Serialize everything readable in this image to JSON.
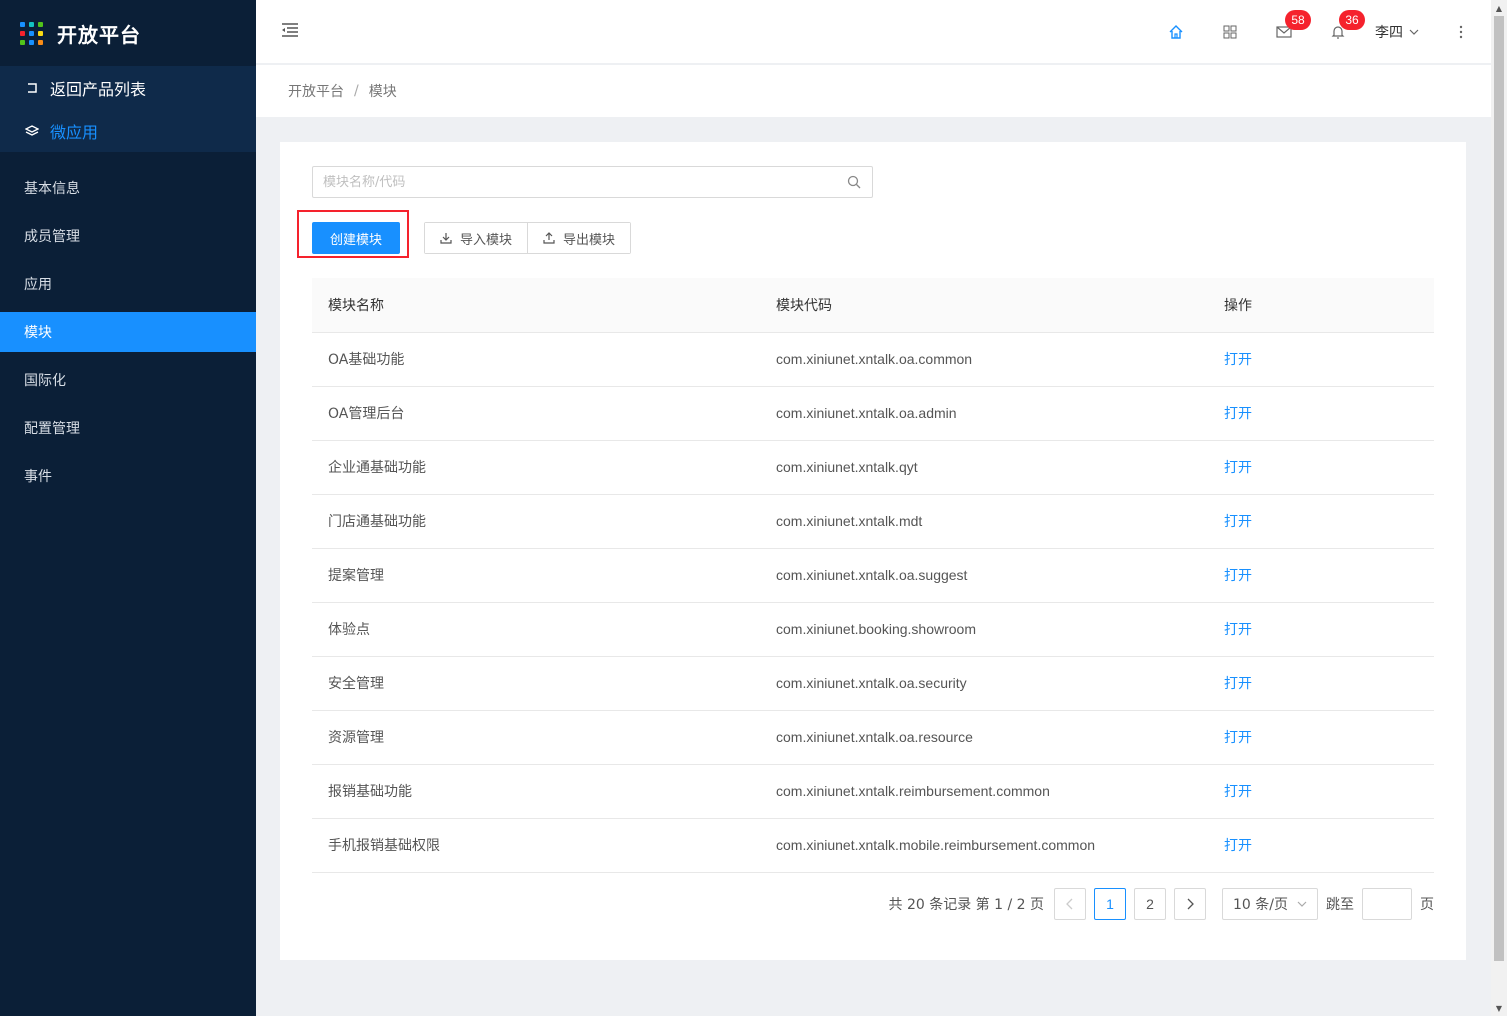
{
  "brand": {
    "title": "开放平台"
  },
  "sub_nav": {
    "back_label": "返回产品列表",
    "app_label": "微应用"
  },
  "menu": [
    {
      "label": "基本信息"
    },
    {
      "label": "成员管理"
    },
    {
      "label": "应用"
    },
    {
      "label": "模块"
    },
    {
      "label": "国际化"
    },
    {
      "label": "配置管理"
    },
    {
      "label": "事件"
    }
  ],
  "header": {
    "mail_badge": "58",
    "bell_badge": "36",
    "user_name": "李四"
  },
  "breadcrumb": {
    "root": "开放平台",
    "sep": "/",
    "current": "模块"
  },
  "search": {
    "placeholder": "模块名称/代码",
    "value": ""
  },
  "toolbar": {
    "create_label": "创建模块",
    "import_label": "导入模块",
    "export_label": "导出模块"
  },
  "table": {
    "headers": {
      "name": "模块名称",
      "code": "模块代码",
      "action": "操作"
    },
    "rows": [
      {
        "name": "OA基础功能",
        "code": "com.xiniunet.xntalk.oa.common",
        "action": "打开"
      },
      {
        "name": "OA管理后台",
        "code": "com.xiniunet.xntalk.oa.admin",
        "action": "打开"
      },
      {
        "name": "企业通基础功能",
        "code": "com.xiniunet.xntalk.qyt",
        "action": "打开"
      },
      {
        "name": "门店通基础功能",
        "code": "com.xiniunet.xntalk.mdt",
        "action": "打开"
      },
      {
        "name": "提案管理",
        "code": "com.xiniunet.xntalk.oa.suggest",
        "action": "打开"
      },
      {
        "name": "体验点",
        "code": "com.xiniunet.booking.showroom",
        "action": "打开"
      },
      {
        "name": "安全管理",
        "code": "com.xiniunet.xntalk.oa.security",
        "action": "打开"
      },
      {
        "name": "资源管理",
        "code": "com.xiniunet.xntalk.oa.resource",
        "action": "打开"
      },
      {
        "name": "报销基础功能",
        "code": "com.xiniunet.xntalk.reimbursement.common",
        "action": "打开"
      },
      {
        "name": "手机报销基础权限",
        "code": "com.xiniunet.xntalk.mobile.reimbursement.common",
        "action": "打开"
      }
    ]
  },
  "pagination": {
    "total_text": "共 20 条记录 第 1 / 2 页",
    "pages": [
      "1",
      "2"
    ],
    "current_page": "1",
    "page_size": "10 条/页",
    "jump_label": "跳至",
    "page_suffix": "页"
  },
  "colors": {
    "primary": "#1890ff",
    "sidebar_bg": "#0b1f37",
    "highlight": "#f5222d",
    "badge": "#f5222d"
  },
  "icons": [
    "apps-grid-icon",
    "back-icon",
    "layers-icon",
    "menu-fold-icon",
    "home-icon",
    "dashboard-icon",
    "mail-icon",
    "bell-icon",
    "more-icon",
    "search-icon",
    "download-icon",
    "upload-icon"
  ]
}
